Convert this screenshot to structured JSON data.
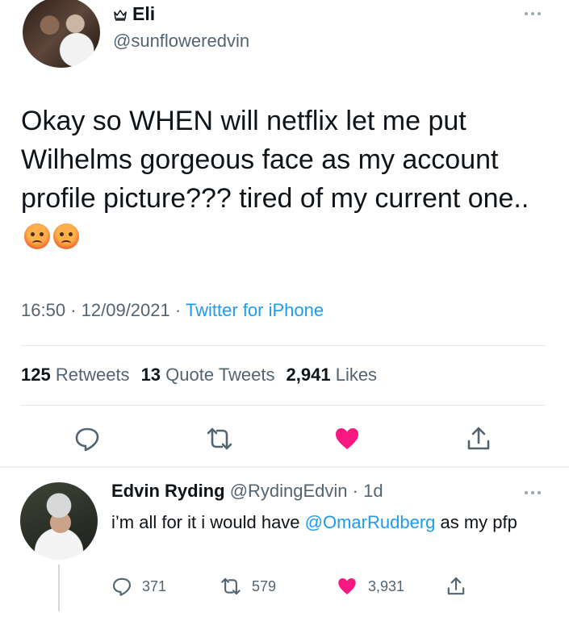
{
  "tweet": {
    "display_name": "Eli",
    "crown_icon": "crown-icon",
    "handle": "@sunfloweredvin",
    "text": "Okay so WHEN will netflix let me put Wilhelms gorgeous face as my account profile picture??? tired of my current one.. ",
    "emoji": "angry-face-emoji",
    "time": "16:50",
    "date": "12/09/2021",
    "separator": "·",
    "source": "Twitter for iPhone",
    "stats": {
      "retweets_count": "125",
      "retweets_label": "Retweets",
      "quotes_count": "13",
      "quotes_label": "Quote Tweets",
      "likes_count": "2,941",
      "likes_label": "Likes"
    },
    "actions": [
      "reply-icon",
      "retweet-icon",
      "like-icon-filled",
      "share-icon"
    ],
    "like_color": "#f91880"
  },
  "reply": {
    "display_name": "Edvin Ryding",
    "handle": "@RydingEdvin",
    "time": "· 1d",
    "text_before": "i’m all for it i would have ",
    "mention": "@OmarRudberg",
    "text_after": " as my pfp",
    "replies": "371",
    "retweets": "579",
    "likes": "3,931"
  },
  "colors": {
    "link": "#1d9bf0",
    "secondary": "#536471",
    "like": "#f91880"
  }
}
